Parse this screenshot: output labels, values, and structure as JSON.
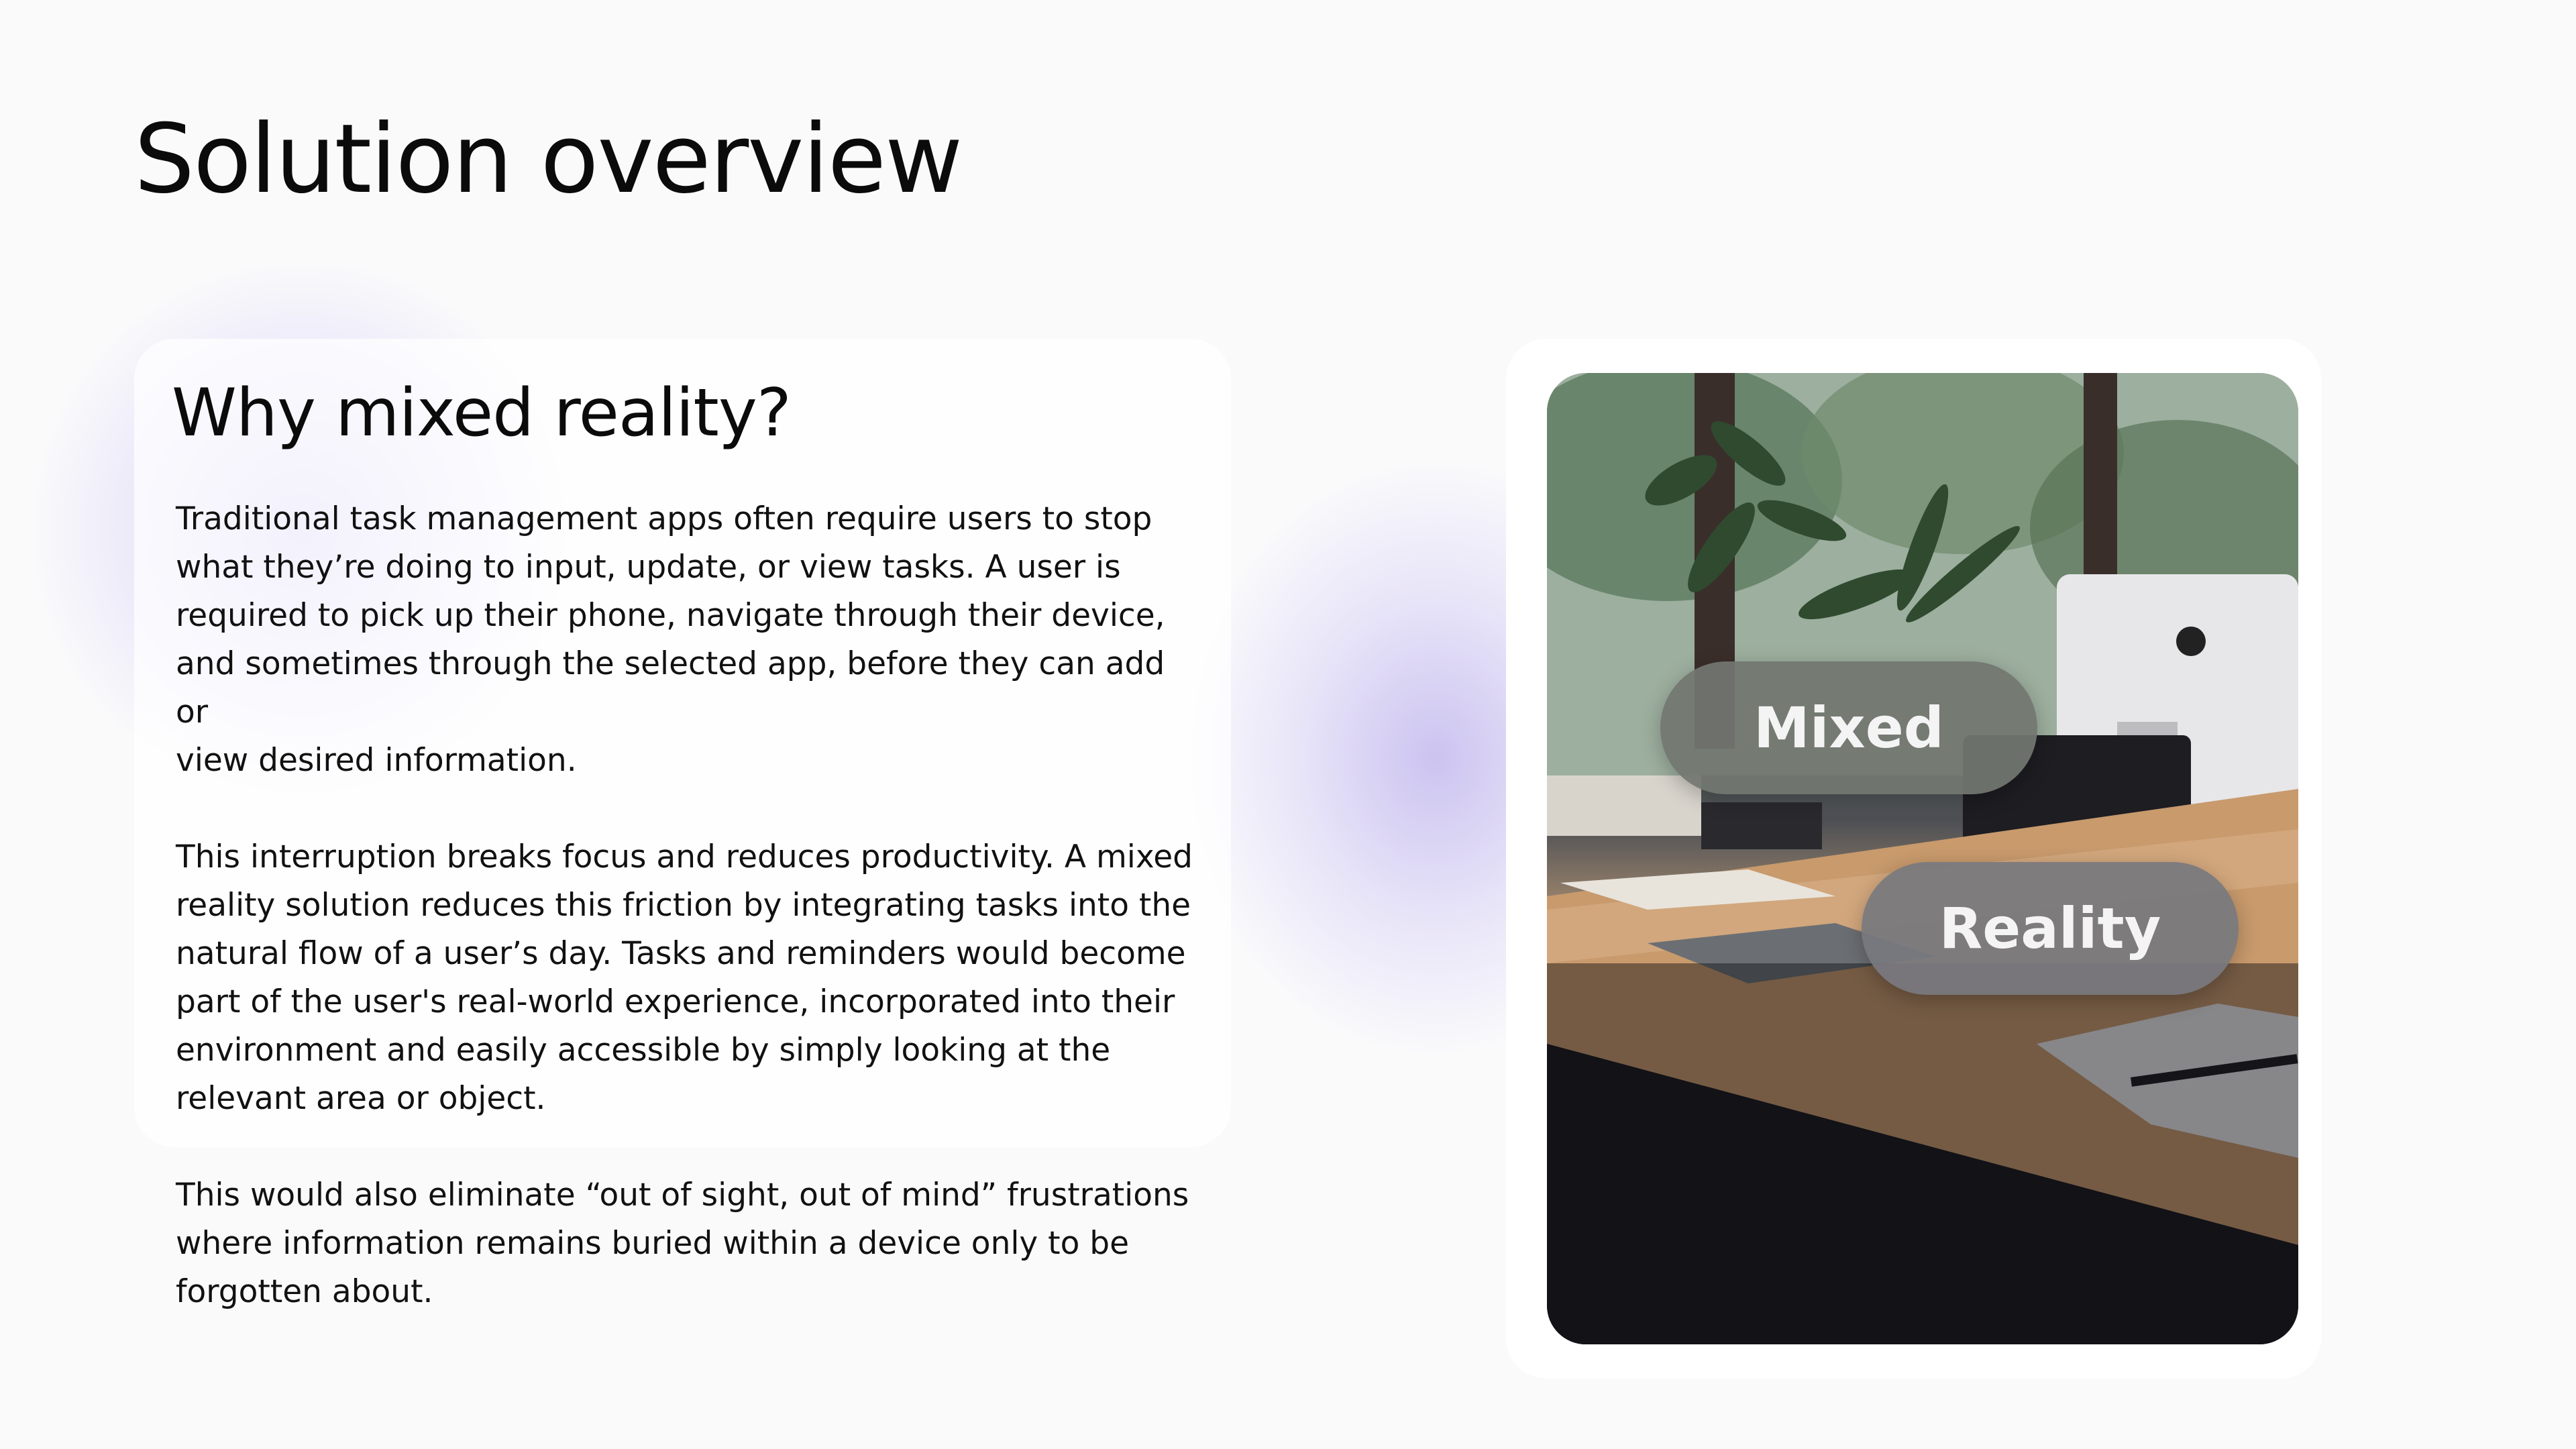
{
  "page": {
    "title": "Solution overview"
  },
  "card": {
    "heading": "Why mixed reality?",
    "paragraphs": [
      "Traditional task management apps often require users to stop\nwhat they’re doing to input, update, or view tasks.  A user is\nrequired to pick up their phone, navigate through their device,\nand sometimes through the selected app, before they can add or\nview desired information.",
      "This interruption breaks focus and reduces productivity. A mixed\nreality solution reduces this friction by integrating tasks into the\nnatural flow of a user’s day. Tasks and reminders would become\npart of the user's real-world experience, incorporated into their\nenvironment and easily accessible by simply looking at the\nrelevant area or object.",
      "This would also eliminate “out of sight, out of mind” frustrations\nwhere information remains buried within a device only to be\nforgotten about."
    ]
  },
  "image": {
    "pill_top": "Mixed",
    "pill_bottom": "Reality"
  }
}
